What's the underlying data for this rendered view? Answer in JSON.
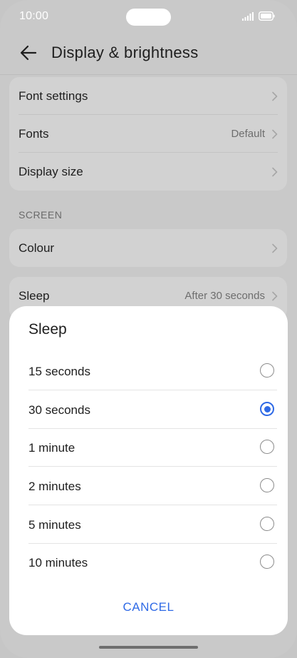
{
  "status_bar": {
    "time": "10:00"
  },
  "header": {
    "title": "Display & brightness"
  },
  "group1": {
    "items": [
      {
        "label": "Font settings",
        "value": ""
      },
      {
        "label": "Fonts",
        "value": "Default"
      },
      {
        "label": "Display size",
        "value": ""
      }
    ]
  },
  "section_screen": "SCREEN",
  "colour_item": {
    "label": "Colour"
  },
  "sleep_item": {
    "label": "Sleep",
    "value": "After 30 seconds"
  },
  "dialog": {
    "title": "Sleep",
    "options": [
      {
        "label": "15 seconds",
        "selected": false
      },
      {
        "label": "30 seconds",
        "selected": true
      },
      {
        "label": "1 minute",
        "selected": false
      },
      {
        "label": "2 minutes",
        "selected": false
      },
      {
        "label": "5 minutes",
        "selected": false
      },
      {
        "label": "10 minutes",
        "selected": false
      }
    ],
    "cancel_label": "CANCEL"
  },
  "colors": {
    "accent": "#2f6ae6",
    "scrim_bg": "#c9c9c9"
  },
  "icons": [
    "back-arrow-icon",
    "chevron-right-icon",
    "signal-icon",
    "battery-icon"
  ]
}
